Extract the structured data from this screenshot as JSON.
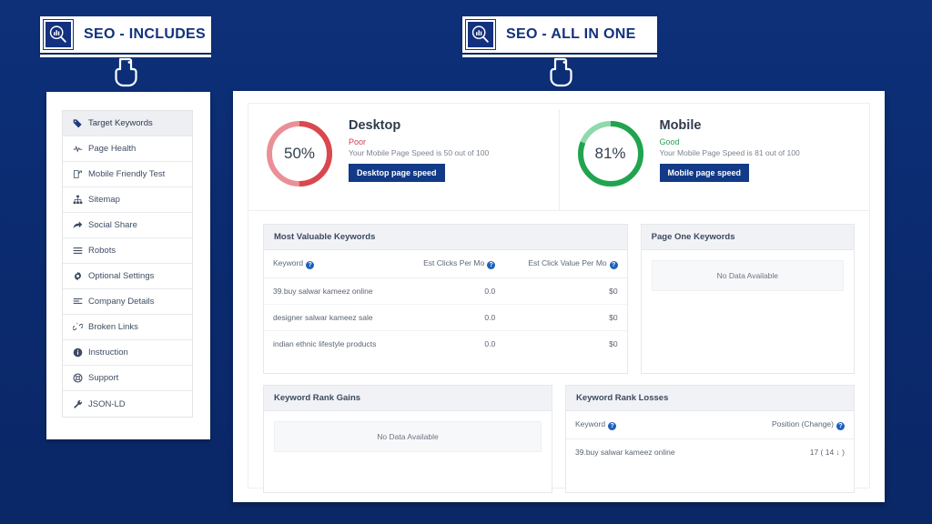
{
  "banners": [
    {
      "id": "includes",
      "title": "SEO - INCLUDES",
      "logo_icon": "seo-magnifier-chart-icon",
      "cursor_icon": "hand-pointer-icon"
    },
    {
      "id": "allinone",
      "title": "SEO - ALL IN ONE",
      "logo_icon": "seo-magnifier-chart-icon",
      "cursor_icon": "hand-pointer-icon"
    }
  ],
  "sidebar": {
    "items": [
      {
        "label": "Target Keywords",
        "icon": "tag-icon",
        "active": true
      },
      {
        "label": "Page Health",
        "icon": "heartbeat-icon",
        "active": false
      },
      {
        "label": "Mobile Friendly Test",
        "icon": "mobile-check-icon",
        "active": false
      },
      {
        "label": "Sitemap",
        "icon": "sitemap-icon",
        "active": false
      },
      {
        "label": "Social Share",
        "icon": "share-icon",
        "active": false
      },
      {
        "label": "Robots",
        "icon": "bars-icon",
        "active": false
      },
      {
        "label": "Optional Settings",
        "icon": "gear-icon",
        "active": false
      },
      {
        "label": "Company Details",
        "icon": "list-icon",
        "active": false
      },
      {
        "label": "Broken Links",
        "icon": "chain-broken-icon",
        "active": false
      },
      {
        "label": "Instruction",
        "icon": "info-icon",
        "active": false
      },
      {
        "label": "Support",
        "icon": "lifebuoy-icon",
        "active": false
      },
      {
        "label": "JSON-LD",
        "icon": "wrench-icon",
        "active": false
      }
    ]
  },
  "scores": [
    {
      "id": "desktop",
      "percent": 50,
      "percent_label": "50%",
      "title": "Desktop",
      "grade": "Poor",
      "grade_class": "poor",
      "description": "Your Mobile Page Speed is 50 out of 100",
      "button_label": "Desktop page speed",
      "track_color": "#eb8f97",
      "progress_color": "#d9484f"
    },
    {
      "id": "mobile",
      "percent": 81,
      "percent_label": "81%",
      "title": "Mobile",
      "grade": "Good",
      "grade_class": "good",
      "description": "Your Mobile Page Speed is 81 out of 100",
      "button_label": "Mobile page speed",
      "track_color": "#8fd9ab",
      "progress_color": "#21a44f"
    }
  ],
  "panels": {
    "most_valuable_keywords": {
      "title": "Most Valuable Keywords",
      "columns": [
        "Keyword",
        "Est Clicks Per Mo",
        "Est Click Value Per Mo"
      ],
      "rows": [
        {
          "keyword": "39.buy salwar kameez online",
          "clicks": "0.0",
          "value": "$0"
        },
        {
          "keyword": "designer salwar kameez sale",
          "clicks": "0.0",
          "value": "$0"
        },
        {
          "keyword": "indian ethnic lifestyle products",
          "clicks": "0.0",
          "value": "$0"
        }
      ]
    },
    "page_one_keywords": {
      "title": "Page One Keywords",
      "empty_text": "No Data Available"
    },
    "keyword_rank_gains": {
      "title": "Keyword Rank Gains",
      "empty_text": "No Data Available"
    },
    "keyword_rank_losses": {
      "title": "Keyword Rank Losses",
      "columns": [
        "Keyword",
        "Position (Change)"
      ],
      "rows": [
        {
          "keyword": "39.buy salwar kameez online",
          "position": "17 ( 14 ↓ )"
        }
      ]
    }
  },
  "colors": {
    "page_background": "#0b2d72",
    "brand_blue": "#12317f",
    "button_blue": "#123a86",
    "poor_red": "#cd3b5b",
    "good_green": "#2ea05a"
  }
}
